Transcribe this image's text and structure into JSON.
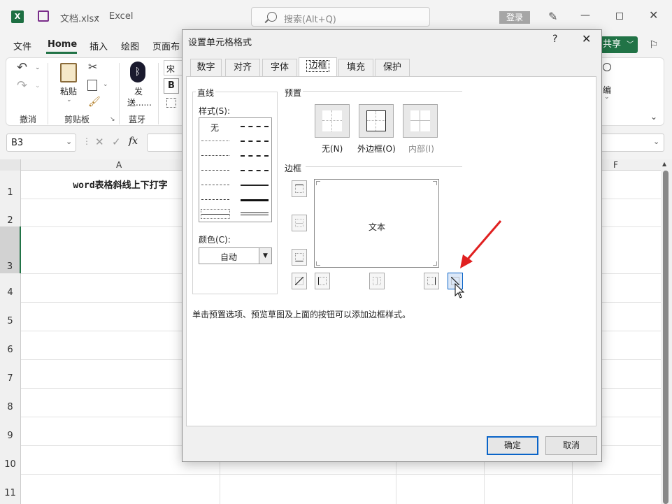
{
  "app": {
    "filename": "文档.xlsx",
    "app_name": "Excel",
    "search_placeholder": "搜索(Alt+Q)",
    "login": "登录",
    "share": "共享"
  },
  "menu": [
    "文件",
    "Home",
    "插入",
    "绘图",
    "页面布"
  ],
  "ribbon": {
    "undo_group": "撤消",
    "paste_label": "粘贴",
    "clipboard_group": "剪贴板",
    "send_label_1": "发",
    "send_label_2": "送......",
    "bluetooth_group": "蓝牙",
    "font_partial": "宋体",
    "bold": "B",
    "edit_partial": "编"
  },
  "formula_bar": {
    "name_box": "B3",
    "fx": "fx"
  },
  "sheet": {
    "col_a": "A",
    "col_f": "F",
    "rows": [
      "1",
      "2",
      "3",
      "4",
      "5",
      "6",
      "7",
      "8",
      "9",
      "10",
      "11"
    ],
    "cell_a1": "word表格斜线上下打字"
  },
  "dialog": {
    "title": "设置单元格格式",
    "help": "?",
    "close": "✕",
    "tabs": [
      "数字",
      "对齐",
      "字体",
      "边框",
      "填充",
      "保护"
    ],
    "active_tab": "边框",
    "line_group": "直线",
    "style_label": "样式(S):",
    "style_none": "无",
    "color_label": "颜色(C):",
    "color_value": "自动",
    "preset_group": "预置",
    "preset_none": "无(N)",
    "preset_outline": "外边框(O)",
    "preset_inside": "内部(I)",
    "border_group": "边框",
    "preview_text": "文本",
    "hint": "单击预置选项、预览草图及上面的按钮可以添加边框样式。",
    "ok": "确定",
    "cancel": "取消"
  },
  "colors": {
    "accent": "#217346",
    "annotation_arrow": "#e02020",
    "focus": "#0a64c8"
  }
}
